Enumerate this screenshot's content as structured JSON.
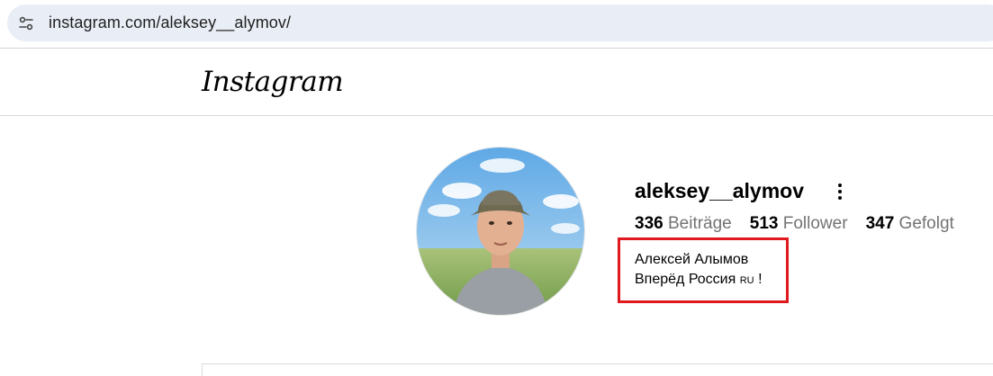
{
  "browser": {
    "url": "instagram.com/aleksey__alymov/",
    "site_icon": "site-info-icon"
  },
  "header": {
    "logo_text": "Instagram"
  },
  "profile": {
    "username": "aleksey__alymov",
    "more_icon": "more-options-icon",
    "stats": {
      "posts_count": "336",
      "posts_label": "Beiträge",
      "followers_count": "513",
      "followers_label": "Follower",
      "following_count": "347",
      "following_label": "Gefolgt"
    },
    "bio": {
      "line1": "Алексей Алымов",
      "line2_text": "Вперёд Россия ",
      "line2_flag": "RU",
      "line2_end": " !"
    }
  },
  "colors": {
    "highlight": "#e0191f",
    "omnibox_bg": "#e9eef6",
    "secondary_text": "#737373"
  }
}
